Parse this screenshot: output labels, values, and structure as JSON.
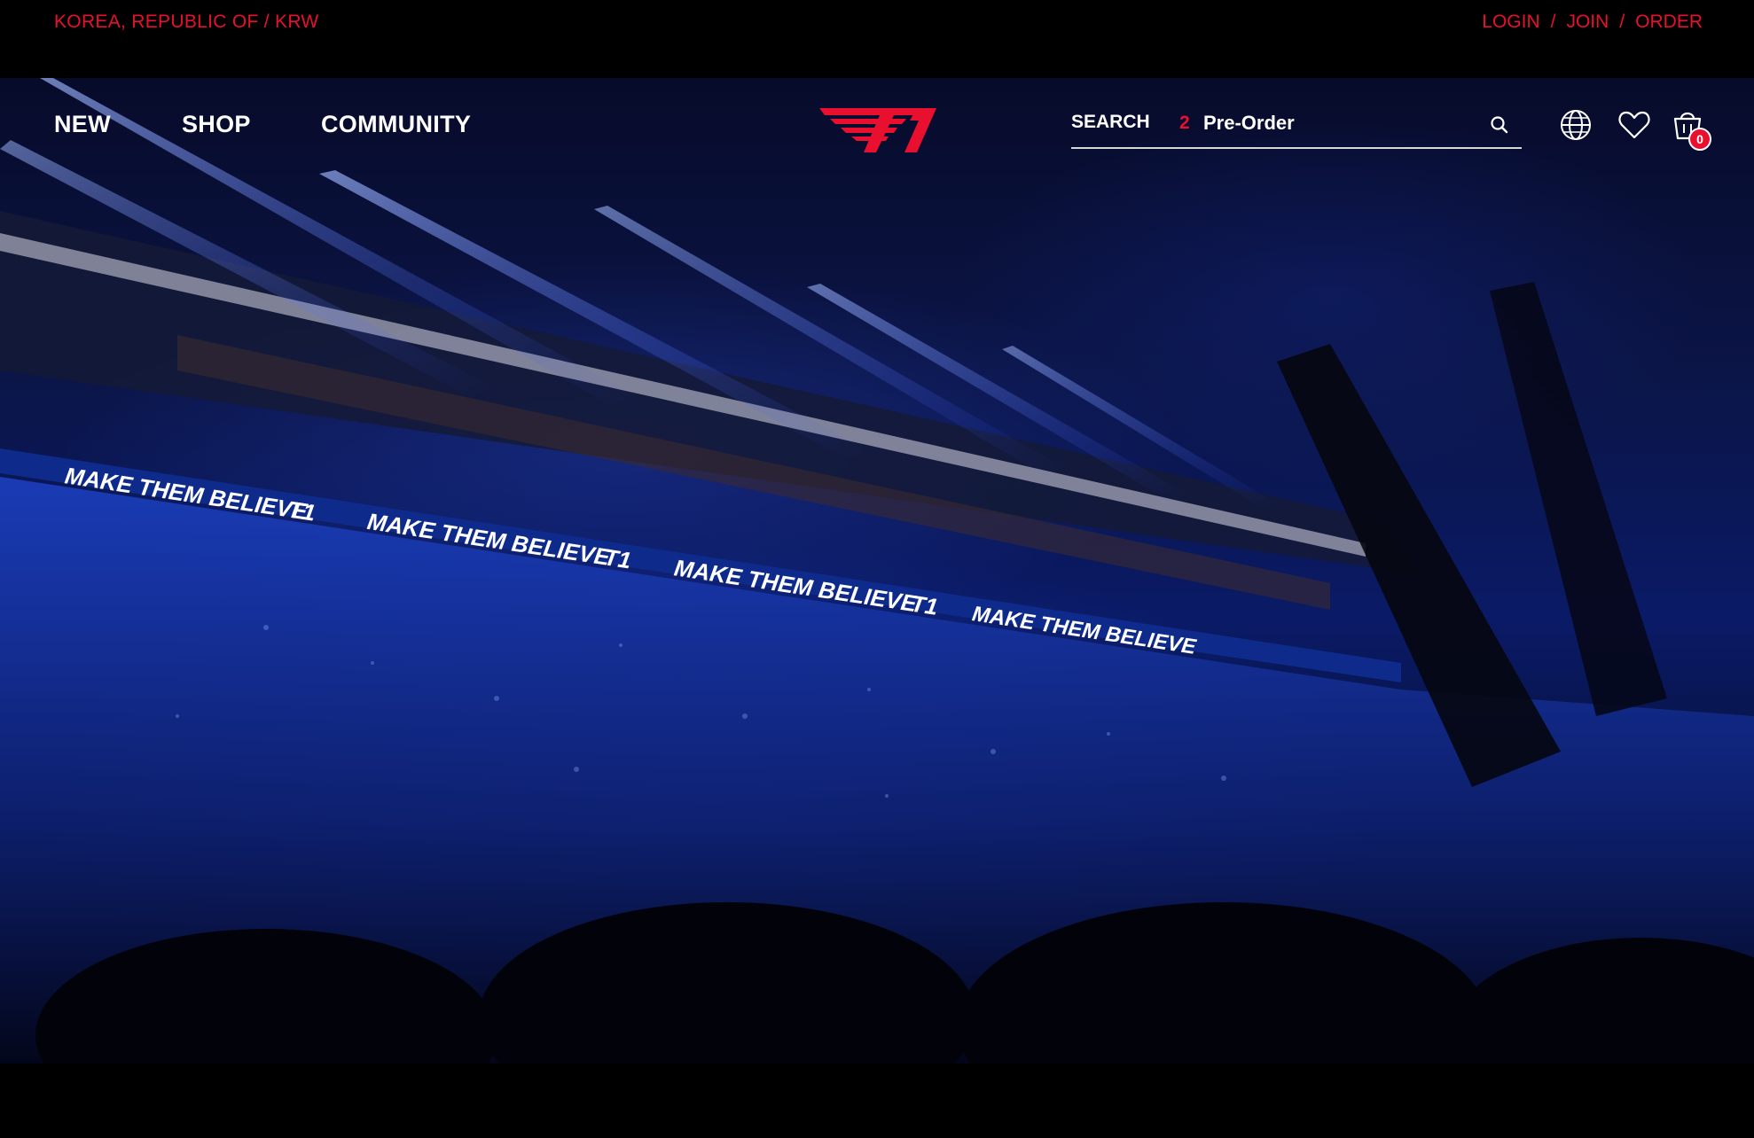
{
  "topbar": {
    "region": "KOREA, REPUBLIC OF / KRW",
    "login": "LOGIN",
    "join": "JOIN",
    "order": "ORDER",
    "separator": "/"
  },
  "nav": {
    "items": [
      {
        "label": "NEW"
      },
      {
        "label": "SHOP"
      },
      {
        "label": "COMMUNITY"
      }
    ]
  },
  "search": {
    "label": "SEARCH",
    "trending_rank": "2",
    "trending_term": "Pre-Order"
  },
  "cart": {
    "count": "0"
  },
  "hero": {
    "ribbon_slogan": "MAKE THEM BELIEVE",
    "ribbon_team": "T1"
  },
  "colors": {
    "accent": "#e8102e",
    "nav_text": "#ffffff",
    "background": "#000000"
  },
  "icons": [
    "search-icon",
    "globe-icon",
    "heart-icon",
    "cart-icon",
    "t1-logo"
  ]
}
